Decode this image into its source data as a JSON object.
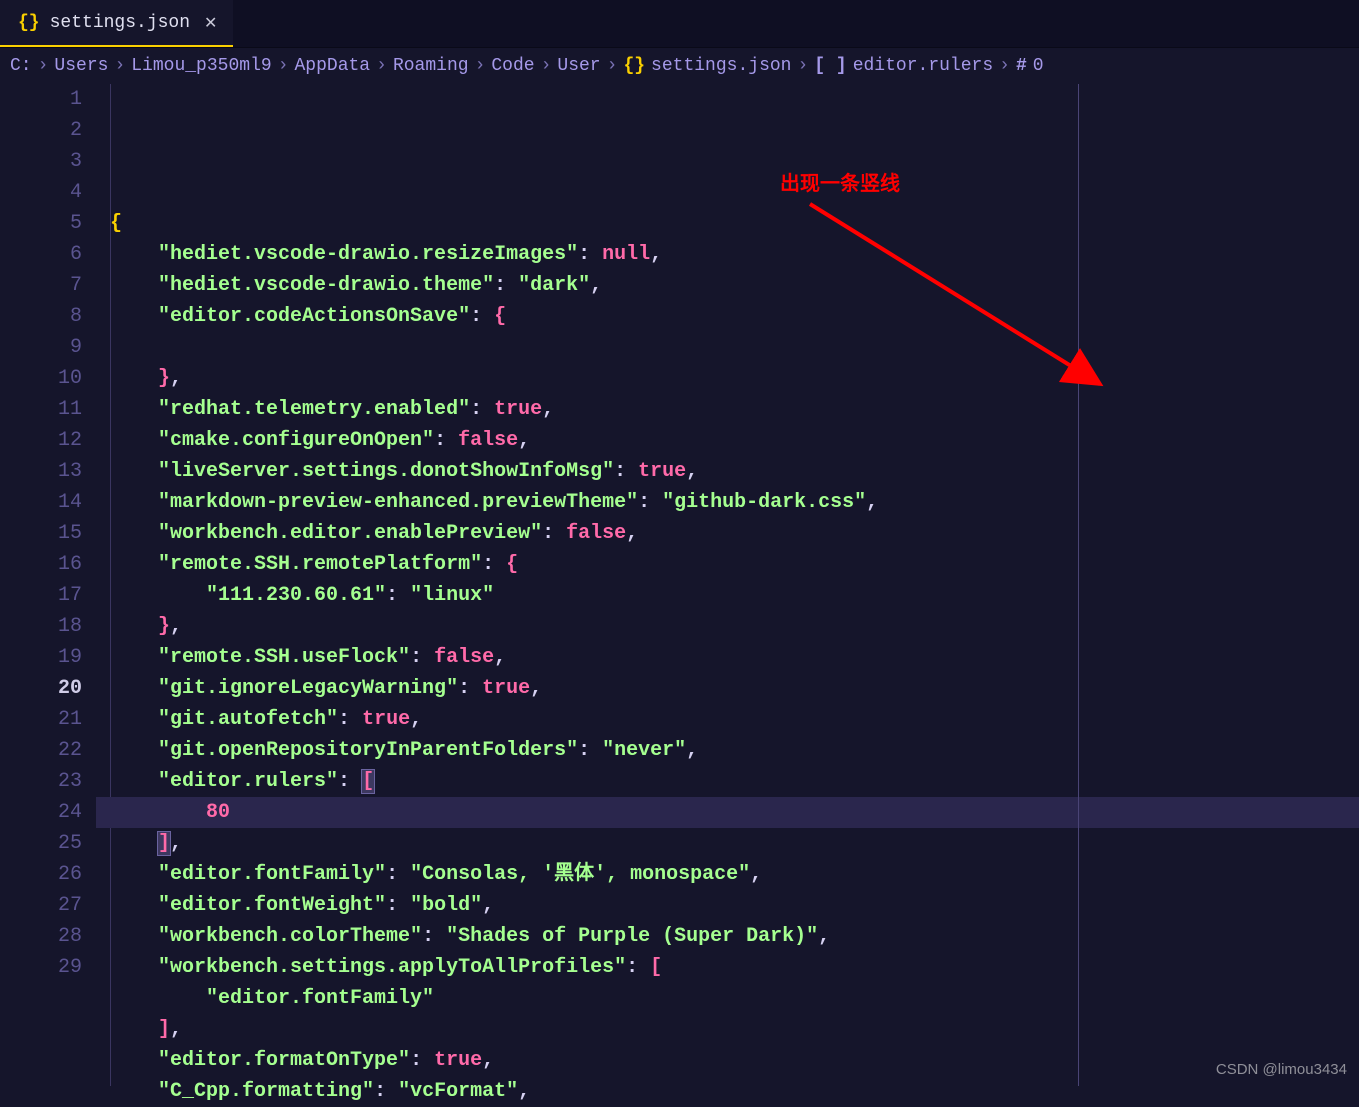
{
  "tab": {
    "icon": "{}",
    "label": "settings.json",
    "close": "✕"
  },
  "breadcrumbs": {
    "sep": "›",
    "parts": [
      "C:",
      "Users",
      "Limou_p350ml9",
      "AppData",
      "Roaming",
      "Code",
      "User"
    ],
    "file_icon": "{}",
    "file": "settings.json",
    "arr_icon": "[ ]",
    "arr": "editor.rulers",
    "idx_icon": "#",
    "idx": "0"
  },
  "annotation": "出现一条竖线",
  "watermark": "CSDN @limou3434",
  "code": {
    "lines": [
      {
        "n": 1,
        "tokens": [
          {
            "t": "br-yellow",
            "v": "{"
          }
        ]
      },
      {
        "n": 2,
        "indent": 1,
        "tokens": [
          {
            "t": "str",
            "v": "\"hediet.vscode-drawio.resizeImages\""
          },
          {
            "t": "punc",
            "v": ": "
          },
          {
            "t": "null",
            "v": "null"
          },
          {
            "t": "punc",
            "v": ","
          }
        ]
      },
      {
        "n": 3,
        "indent": 1,
        "tokens": [
          {
            "t": "str",
            "v": "\"hediet.vscode-drawio.theme\""
          },
          {
            "t": "punc",
            "v": ": "
          },
          {
            "t": "str",
            "v": "\"dark\""
          },
          {
            "t": "punc",
            "v": ","
          }
        ]
      },
      {
        "n": 4,
        "indent": 1,
        "tokens": [
          {
            "t": "str",
            "v": "\"editor.codeActionsOnSave\""
          },
          {
            "t": "punc",
            "v": ": "
          },
          {
            "t": "br-pink",
            "v": "{"
          }
        ]
      },
      {
        "n": 5,
        "indent": 1,
        "tokens": []
      },
      {
        "n": 6,
        "indent": 1,
        "tokens": [
          {
            "t": "br-pink",
            "v": "}"
          },
          {
            "t": "punc",
            "v": ","
          }
        ]
      },
      {
        "n": 7,
        "indent": 1,
        "tokens": [
          {
            "t": "str",
            "v": "\"redhat.telemetry.enabled\""
          },
          {
            "t": "punc",
            "v": ": "
          },
          {
            "t": "bool",
            "v": "true"
          },
          {
            "t": "punc",
            "v": ","
          }
        ]
      },
      {
        "n": 8,
        "indent": 1,
        "tokens": [
          {
            "t": "str",
            "v": "\"cmake.configureOnOpen\""
          },
          {
            "t": "punc",
            "v": ": "
          },
          {
            "t": "bool",
            "v": "false"
          },
          {
            "t": "punc",
            "v": ","
          }
        ]
      },
      {
        "n": 9,
        "indent": 1,
        "tokens": [
          {
            "t": "str",
            "v": "\"liveServer.settings.donotShowInfoMsg\""
          },
          {
            "t": "punc",
            "v": ": "
          },
          {
            "t": "bool",
            "v": "true"
          },
          {
            "t": "punc",
            "v": ","
          }
        ]
      },
      {
        "n": 10,
        "indent": 1,
        "tokens": [
          {
            "t": "str",
            "v": "\"markdown-preview-enhanced.previewTheme\""
          },
          {
            "t": "punc",
            "v": ": "
          },
          {
            "t": "str",
            "v": "\"github-dark.css\""
          },
          {
            "t": "punc",
            "v": ","
          }
        ]
      },
      {
        "n": 11,
        "indent": 1,
        "tokens": [
          {
            "t": "str",
            "v": "\"workbench.editor.enablePreview\""
          },
          {
            "t": "punc",
            "v": ": "
          },
          {
            "t": "bool",
            "v": "false"
          },
          {
            "t": "punc",
            "v": ","
          }
        ]
      },
      {
        "n": 12,
        "indent": 1,
        "tokens": [
          {
            "t": "str",
            "v": "\"remote.SSH.remotePlatform\""
          },
          {
            "t": "punc",
            "v": ": "
          },
          {
            "t": "br-pink",
            "v": "{"
          }
        ]
      },
      {
        "n": 13,
        "indent": 2,
        "tokens": [
          {
            "t": "str",
            "v": "\"111.230.60.61\""
          },
          {
            "t": "punc",
            "v": ": "
          },
          {
            "t": "str",
            "v": "\"linux\""
          }
        ]
      },
      {
        "n": 14,
        "indent": 1,
        "tokens": [
          {
            "t": "br-pink",
            "v": "}"
          },
          {
            "t": "punc",
            "v": ","
          }
        ]
      },
      {
        "n": 15,
        "indent": 1,
        "tokens": [
          {
            "t": "str",
            "v": "\"remote.SSH.useFlock\""
          },
          {
            "t": "punc",
            "v": ": "
          },
          {
            "t": "bool",
            "v": "false"
          },
          {
            "t": "punc",
            "v": ","
          }
        ]
      },
      {
        "n": 16,
        "indent": 1,
        "tokens": [
          {
            "t": "str",
            "v": "\"git.ignoreLegacyWarning\""
          },
          {
            "t": "punc",
            "v": ": "
          },
          {
            "t": "bool",
            "v": "true"
          },
          {
            "t": "punc",
            "v": ","
          }
        ]
      },
      {
        "n": 17,
        "indent": 1,
        "tokens": [
          {
            "t": "str",
            "v": "\"git.autofetch\""
          },
          {
            "t": "punc",
            "v": ": "
          },
          {
            "t": "bool",
            "v": "true"
          },
          {
            "t": "punc",
            "v": ","
          }
        ]
      },
      {
        "n": 18,
        "indent": 1,
        "tokens": [
          {
            "t": "str",
            "v": "\"git.openRepositoryInParentFolders\""
          },
          {
            "t": "punc",
            "v": ": "
          },
          {
            "t": "str",
            "v": "\"never\""
          },
          {
            "t": "punc",
            "v": ","
          }
        ]
      },
      {
        "n": 19,
        "indent": 1,
        "tokens": [
          {
            "t": "str",
            "v": "\"editor.rulers\""
          },
          {
            "t": "punc",
            "v": ": "
          },
          {
            "t": "br-pink br-hl",
            "v": "["
          }
        ]
      },
      {
        "n": 20,
        "indent": 2,
        "hl": true,
        "tokens": [
          {
            "t": "num",
            "v": "80"
          }
        ]
      },
      {
        "n": 21,
        "indent": 1,
        "tokens": [
          {
            "t": "br-pink br-hl",
            "v": "]"
          },
          {
            "t": "punc",
            "v": ","
          }
        ]
      },
      {
        "n": 22,
        "indent": 1,
        "tokens": [
          {
            "t": "str",
            "v": "\"editor.fontFamily\""
          },
          {
            "t": "punc",
            "v": ": "
          },
          {
            "t": "str",
            "v": "\"Consolas, '黑体', monospace\""
          },
          {
            "t": "punc",
            "v": ","
          }
        ]
      },
      {
        "n": 23,
        "indent": 1,
        "tokens": [
          {
            "t": "str",
            "v": "\"editor.fontWeight\""
          },
          {
            "t": "punc",
            "v": ": "
          },
          {
            "t": "str",
            "v": "\"bold\""
          },
          {
            "t": "punc",
            "v": ","
          }
        ]
      },
      {
        "n": 24,
        "indent": 1,
        "tokens": [
          {
            "t": "str",
            "v": "\"workbench.colorTheme\""
          },
          {
            "t": "punc",
            "v": ": "
          },
          {
            "t": "str",
            "v": "\"Shades of Purple (Super Dark)\""
          },
          {
            "t": "punc",
            "v": ","
          }
        ]
      },
      {
        "n": 25,
        "indent": 1,
        "tokens": [
          {
            "t": "str",
            "v": "\"workbench.settings.applyToAllProfiles\""
          },
          {
            "t": "punc",
            "v": ": "
          },
          {
            "t": "br-pink",
            "v": "["
          }
        ]
      },
      {
        "n": 26,
        "indent": 2,
        "tokens": [
          {
            "t": "str",
            "v": "\"editor.fontFamily\""
          }
        ]
      },
      {
        "n": 27,
        "indent": 1,
        "tokens": [
          {
            "t": "br-pink",
            "v": "]"
          },
          {
            "t": "punc",
            "v": ","
          }
        ]
      },
      {
        "n": 28,
        "indent": 1,
        "tokens": [
          {
            "t": "str",
            "v": "\"editor.formatOnType\""
          },
          {
            "t": "punc",
            "v": ": "
          },
          {
            "t": "bool",
            "v": "true"
          },
          {
            "t": "punc",
            "v": ","
          }
        ]
      },
      {
        "n": 29,
        "indent": 1,
        "tokens": [
          {
            "t": "str",
            "v": "\"C_Cpp.formatting\""
          },
          {
            "t": "punc",
            "v": ": "
          },
          {
            "t": "str",
            "v": "\"vcFormat\""
          },
          {
            "t": "punc",
            "v": ","
          }
        ]
      }
    ],
    "current_line": 20,
    "ruler_col": 80
  }
}
